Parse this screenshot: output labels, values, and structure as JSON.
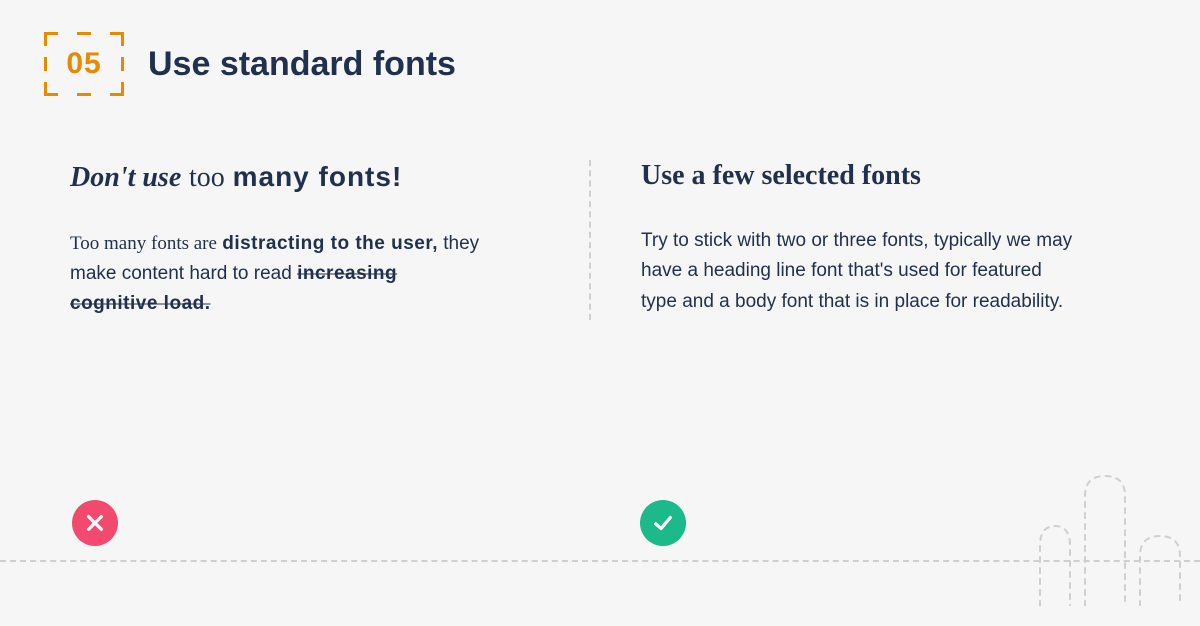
{
  "header": {
    "number": "05",
    "title": "Use standard fonts"
  },
  "left": {
    "heading": {
      "part1": "Don't use",
      "part2": "too",
      "part3": "many fonts!"
    },
    "body": {
      "part1": "Too many fonts are",
      "part2": "distracting to the user,",
      "part3": "they make content hard to read",
      "part4": "increasing cognitive load."
    },
    "status": "bad"
  },
  "right": {
    "heading": "Use a few selected fonts",
    "body": "Try to stick with two or three fonts, typically we may have a heading line font that's used for featured type and a body font that is in place for readability.",
    "status": "good"
  },
  "colors": {
    "accent": "#e88a00",
    "text": "#21314d",
    "bad": "#f24a6e",
    "good": "#1cb98b",
    "dash": "#cfcfcf"
  }
}
